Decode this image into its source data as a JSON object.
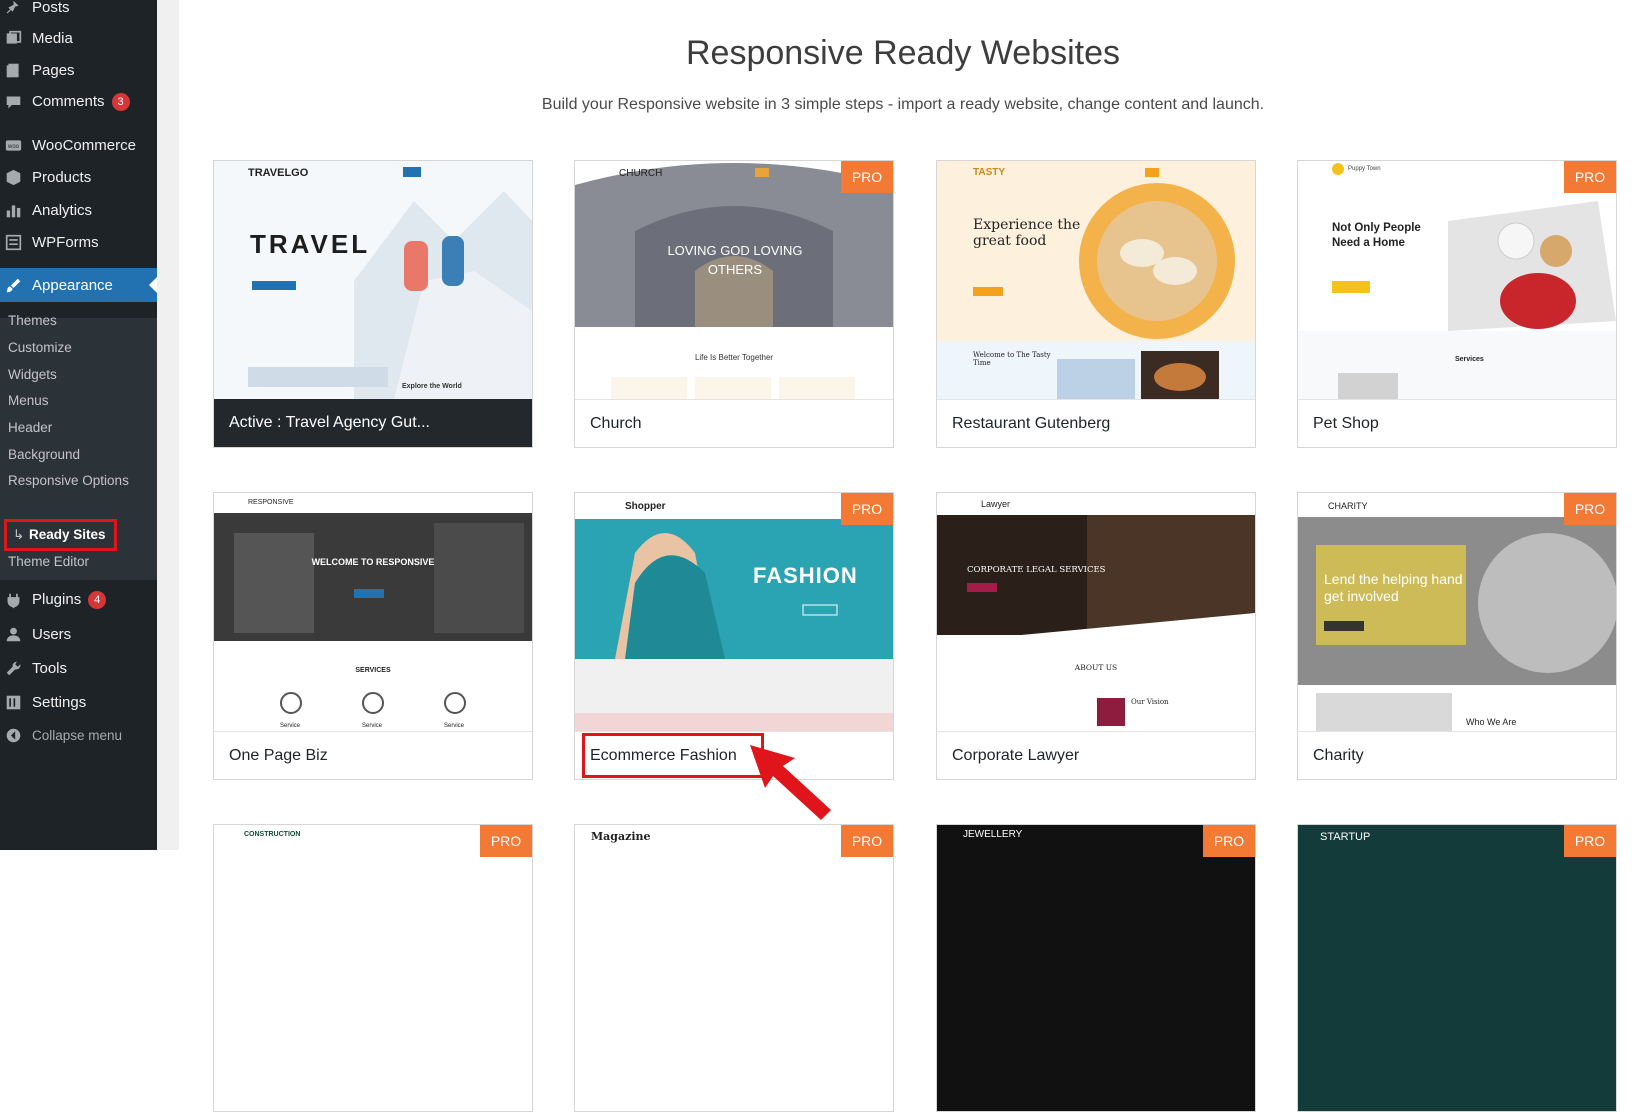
{
  "sidebar": {
    "posts": "Posts",
    "media": "Media",
    "pages": "Pages",
    "comments": "Comments",
    "comments_count": "3",
    "woocommerce": "WooCommerce",
    "products": "Products",
    "analytics": "Analytics",
    "wpforms": "WPForms",
    "appearance": "Appearance",
    "submenu": [
      "Themes",
      "Customize",
      "Widgets",
      "Menus",
      "Header",
      "Background",
      "Responsive Options",
      "Ready Sites",
      "Theme Editor"
    ],
    "plugins": "Plugins",
    "plugins_count": "4",
    "users": "Users",
    "tools": "Tools",
    "settings": "Settings",
    "collapse": "Collapse menu"
  },
  "header": {
    "title": "Responsive Ready Websites",
    "subtitle": "Build your Responsive website in 3 simple steps - import a ready website, change content and launch."
  },
  "sites": [
    {
      "name": "Active : Travel Agency Gut...",
      "pro": false,
      "logo": "TRAVELGO",
      "hero": "TRAVEL",
      "extra": "Explore the World"
    },
    {
      "name": "Church",
      "pro": true,
      "logo": "CHURCH",
      "hero": "LOVING GOD LOVING OTHERS",
      "extra": "Life Is Better Together"
    },
    {
      "name": "Restaurant Gutenberg",
      "pro": false,
      "logo": "TASTY",
      "hero": "Experience the great food",
      "extra": "Welcome to The Tasty Time"
    },
    {
      "name": "Pet Shop",
      "pro": true,
      "logo": "Puppy Town",
      "hero": "Not Only People Need a Home",
      "extra": "Services"
    },
    {
      "name": "One Page Biz",
      "pro": false,
      "logo": "RESPONSIVE",
      "hero": "WELCOME TO RESPONSIVE",
      "extra": "SERVICES",
      "service": "Service"
    },
    {
      "name": "Ecommerce Fashion",
      "pro": true,
      "logo": "Shopper",
      "hero": "FASHION",
      "extra": ""
    },
    {
      "name": "Corporate Lawyer",
      "pro": false,
      "logo": "Lawyer",
      "hero": "CORPORATE LEGAL SERVICES",
      "extra": "ABOUT US",
      "extra2": "Our Vision"
    },
    {
      "name": "Charity",
      "pro": true,
      "logo": "CHARITY",
      "hero": "Lend the helping hand get involved",
      "extra": "Who We Are"
    },
    {
      "name": "",
      "pro": true,
      "logo": "CONSTRUCTION"
    },
    {
      "name": "",
      "pro": true,
      "logo": "Magazine"
    },
    {
      "name": "",
      "pro": true,
      "logo": "JEWELLERY"
    },
    {
      "name": "",
      "pro": true,
      "logo": "STARTUP"
    }
  ],
  "pro_label": "PRO",
  "colors": {
    "sidebar": "#1e2327",
    "accent": "#2271b1",
    "pro": "#f37a35",
    "highlight": "#e0141b",
    "badge": "#d63638"
  }
}
